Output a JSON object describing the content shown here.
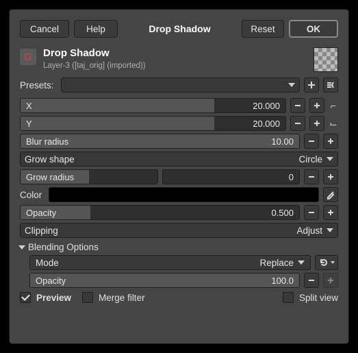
{
  "topbar": {
    "cancel": "Cancel",
    "help": "Help",
    "title": "Drop Shadow",
    "reset": "Reset",
    "ok": "OK"
  },
  "header": {
    "title": "Drop Shadow",
    "subtitle": "Layer-3 ([taj_orig] (imported))",
    "logo": "G"
  },
  "presets": {
    "label": "Presets:"
  },
  "params": {
    "x": {
      "label": "X",
      "value": "20.000",
      "fill": 73
    },
    "y": {
      "label": "Y",
      "value": "20.000",
      "fill": 73
    },
    "blur": {
      "label": "Blur radius",
      "value": "10.00",
      "fill": 100
    },
    "grow_shape": {
      "label": "Grow shape",
      "value": "Circle"
    },
    "grow_radius": {
      "label": "Grow radius",
      "value": "0",
      "fill": 50
    },
    "color": {
      "label": "Color"
    },
    "opacity": {
      "label": "Opacity",
      "value": "0.500",
      "fill": 25
    }
  },
  "clipping": {
    "label": "Clipping",
    "value": "Adjust"
  },
  "blending": {
    "header": "Blending Options",
    "mode": {
      "label": "Mode",
      "value": "Replace"
    },
    "opacity": {
      "label": "Opacity",
      "value": "100.0",
      "fill": 100
    }
  },
  "footer": {
    "preview": "Preview",
    "merge": "Merge filter",
    "split": "Split view"
  }
}
